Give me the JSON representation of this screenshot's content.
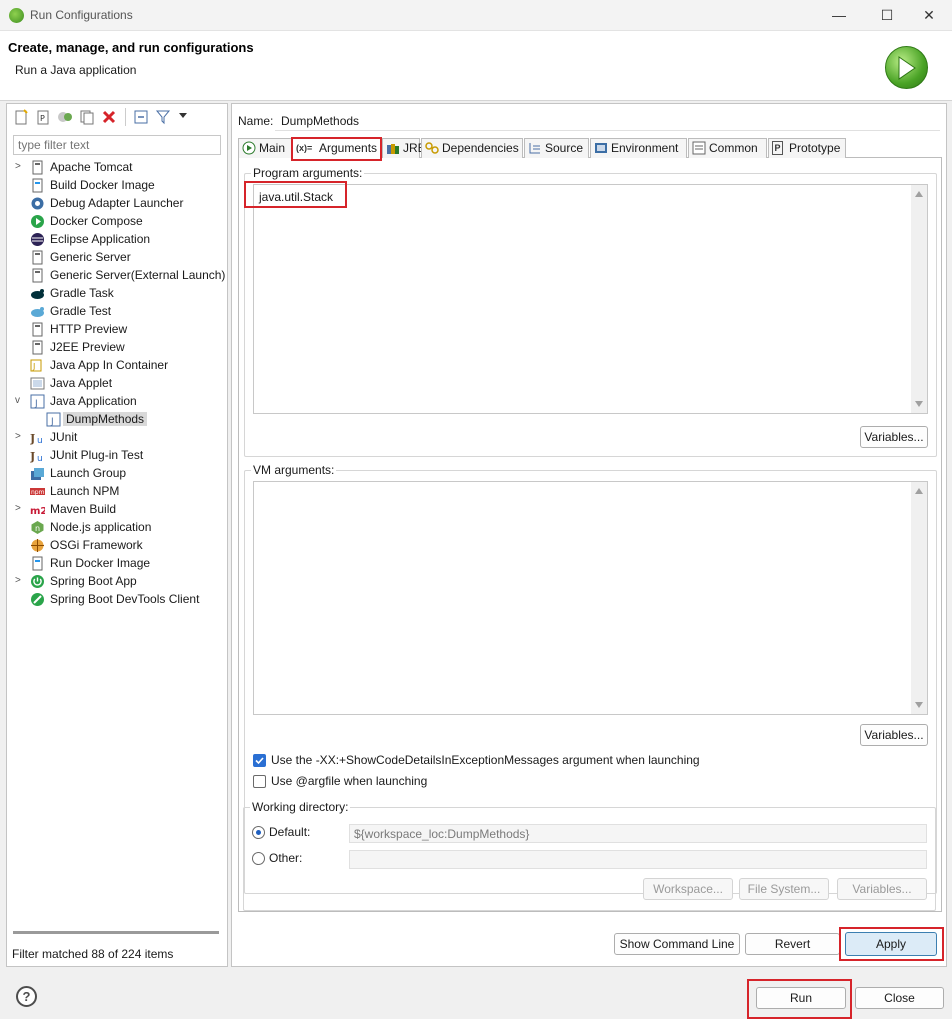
{
  "window": {
    "title": "Run Configurations",
    "minimize": "—",
    "maximize": "☐",
    "close": "✕"
  },
  "header": {
    "title": "Create, manage, and run configurations",
    "subtitle": "Run a Java application"
  },
  "left": {
    "filter_placeholder": "type filter text",
    "tree": [
      {
        "label": "Apache Tomcat",
        "icon": "tomcat-icon",
        "expander": ">"
      },
      {
        "label": "Build Docker Image",
        "icon": "docker-icon",
        "expander": ""
      },
      {
        "label": "Debug Adapter Launcher",
        "icon": "debug-adapter-icon",
        "expander": ""
      },
      {
        "label": "Docker Compose",
        "icon": "docker-compose-icon",
        "expander": ""
      },
      {
        "label": "Eclipse Application",
        "icon": "eclipse-icon",
        "expander": ""
      },
      {
        "label": "Generic Server",
        "icon": "server-icon",
        "expander": ""
      },
      {
        "label": "Generic Server(External Launch)",
        "icon": "server-icon",
        "expander": ""
      },
      {
        "label": "Gradle Task",
        "icon": "gradle-icon",
        "expander": ""
      },
      {
        "label": "Gradle Test",
        "icon": "gradle-test-icon",
        "expander": ""
      },
      {
        "label": "HTTP Preview",
        "icon": "server-icon",
        "expander": ""
      },
      {
        "label": "J2EE Preview",
        "icon": "server-icon",
        "expander": ""
      },
      {
        "label": "Java App In Container",
        "icon": "container-icon",
        "expander": ""
      },
      {
        "label": "Java Applet",
        "icon": "applet-icon",
        "expander": ""
      },
      {
        "label": "Java Application",
        "icon": "java-app-icon",
        "expander": "v"
      },
      {
        "label": "DumpMethods",
        "icon": "java-app-icon",
        "expander": "",
        "child": true,
        "selected": true
      },
      {
        "label": "JUnit",
        "icon": "junit-icon",
        "expander": ">"
      },
      {
        "label": "JUnit Plug-in Test",
        "icon": "junit-plugin-icon",
        "expander": ""
      },
      {
        "label": "Launch Group",
        "icon": "launch-group-icon",
        "expander": ""
      },
      {
        "label": "Launch NPM",
        "icon": "npm-icon",
        "expander": ""
      },
      {
        "label": "Maven Build",
        "icon": "maven-icon",
        "expander": ">"
      },
      {
        "label": "Node.js application",
        "icon": "nodejs-icon",
        "expander": ""
      },
      {
        "label": "OSGi Framework",
        "icon": "osgi-icon",
        "expander": ""
      },
      {
        "label": "Run Docker Image",
        "icon": "docker-icon",
        "expander": ""
      },
      {
        "label": "Spring Boot App",
        "icon": "spring-boot-icon",
        "expander": ">"
      },
      {
        "label": "Spring Boot DevTools Client",
        "icon": "spring-devtools-icon",
        "expander": ""
      }
    ],
    "filter_status": "Filter matched 88 of 224 items"
  },
  "config": {
    "name_label": "Name:",
    "name_value": "DumpMethods",
    "tabs": [
      {
        "label": "Main",
        "icon": "main-tab-icon"
      },
      {
        "label": "Arguments",
        "icon": "arguments-tab-icon",
        "icon_text": "(x)="
      },
      {
        "label": "JRE",
        "icon": "jre-tab-icon"
      },
      {
        "label": "Dependencies",
        "icon": "dependencies-tab-icon"
      },
      {
        "label": "Source",
        "icon": "source-tab-icon"
      },
      {
        "label": "Environment",
        "icon": "environment-tab-icon"
      },
      {
        "label": "Common",
        "icon": "common-tab-icon"
      },
      {
        "label": "Prototype",
        "icon": "prototype-tab-icon",
        "icon_text": "P"
      }
    ],
    "active_tab": "Arguments",
    "program_args_label": "Program arguments:",
    "program_args_value": "java.util.Stack",
    "variables_label": "Variables...",
    "vm_args_label": "VM arguments:",
    "vm_args_value": "",
    "show_code_details_label": "Use the -XX:+ShowCodeDetailsInExceptionMessages argument when launching",
    "show_code_details_checked": true,
    "argfile_label": "Use @argfile when launching",
    "argfile_checked": false,
    "working_dir_label": "Working directory:",
    "default_label": "Default:",
    "default_value": "${workspace_loc:DumpMethods}",
    "other_label": "Other:",
    "other_value": "",
    "workspace_btn": "Workspace...",
    "filesystem_btn": "File System...",
    "wd_variables_btn": "Variables..."
  },
  "actions": {
    "show_cmd": "Show Command Line",
    "revert": "Revert",
    "apply": "Apply",
    "run": "Run",
    "close": "Close",
    "help": "?"
  },
  "colors": {
    "highlight": "#d6242a",
    "accent": "#2a6fd3"
  }
}
